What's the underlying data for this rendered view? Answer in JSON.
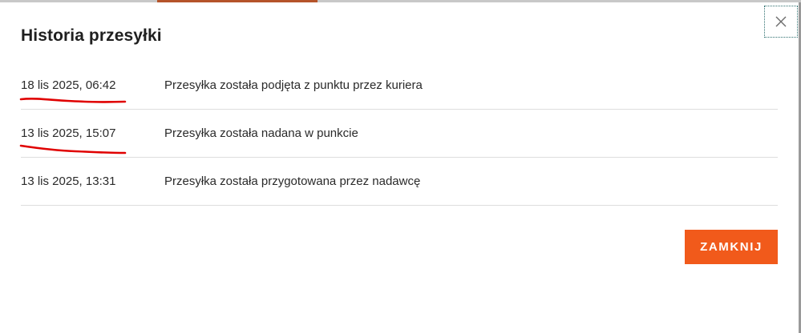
{
  "dialog": {
    "title": "Historia przesyłki",
    "close_icon": "close-icon",
    "close_button_label": "ZAMKNIJ",
    "accent_color": "#f15a1b",
    "annotation_color": "#e00000"
  },
  "history": [
    {
      "date": "18 lis 2025, 06:42",
      "description": "Przesyłka została podjęta z punktu przez kuriera",
      "underlined": true
    },
    {
      "date": "13 lis 2025, 15:07",
      "description": "Przesyłka została nadana w punkcie",
      "underlined": true
    },
    {
      "date": "13 lis 2025, 13:31",
      "description": "Przesyłka została przygotowana przez nadawcę",
      "underlined": false
    }
  ]
}
